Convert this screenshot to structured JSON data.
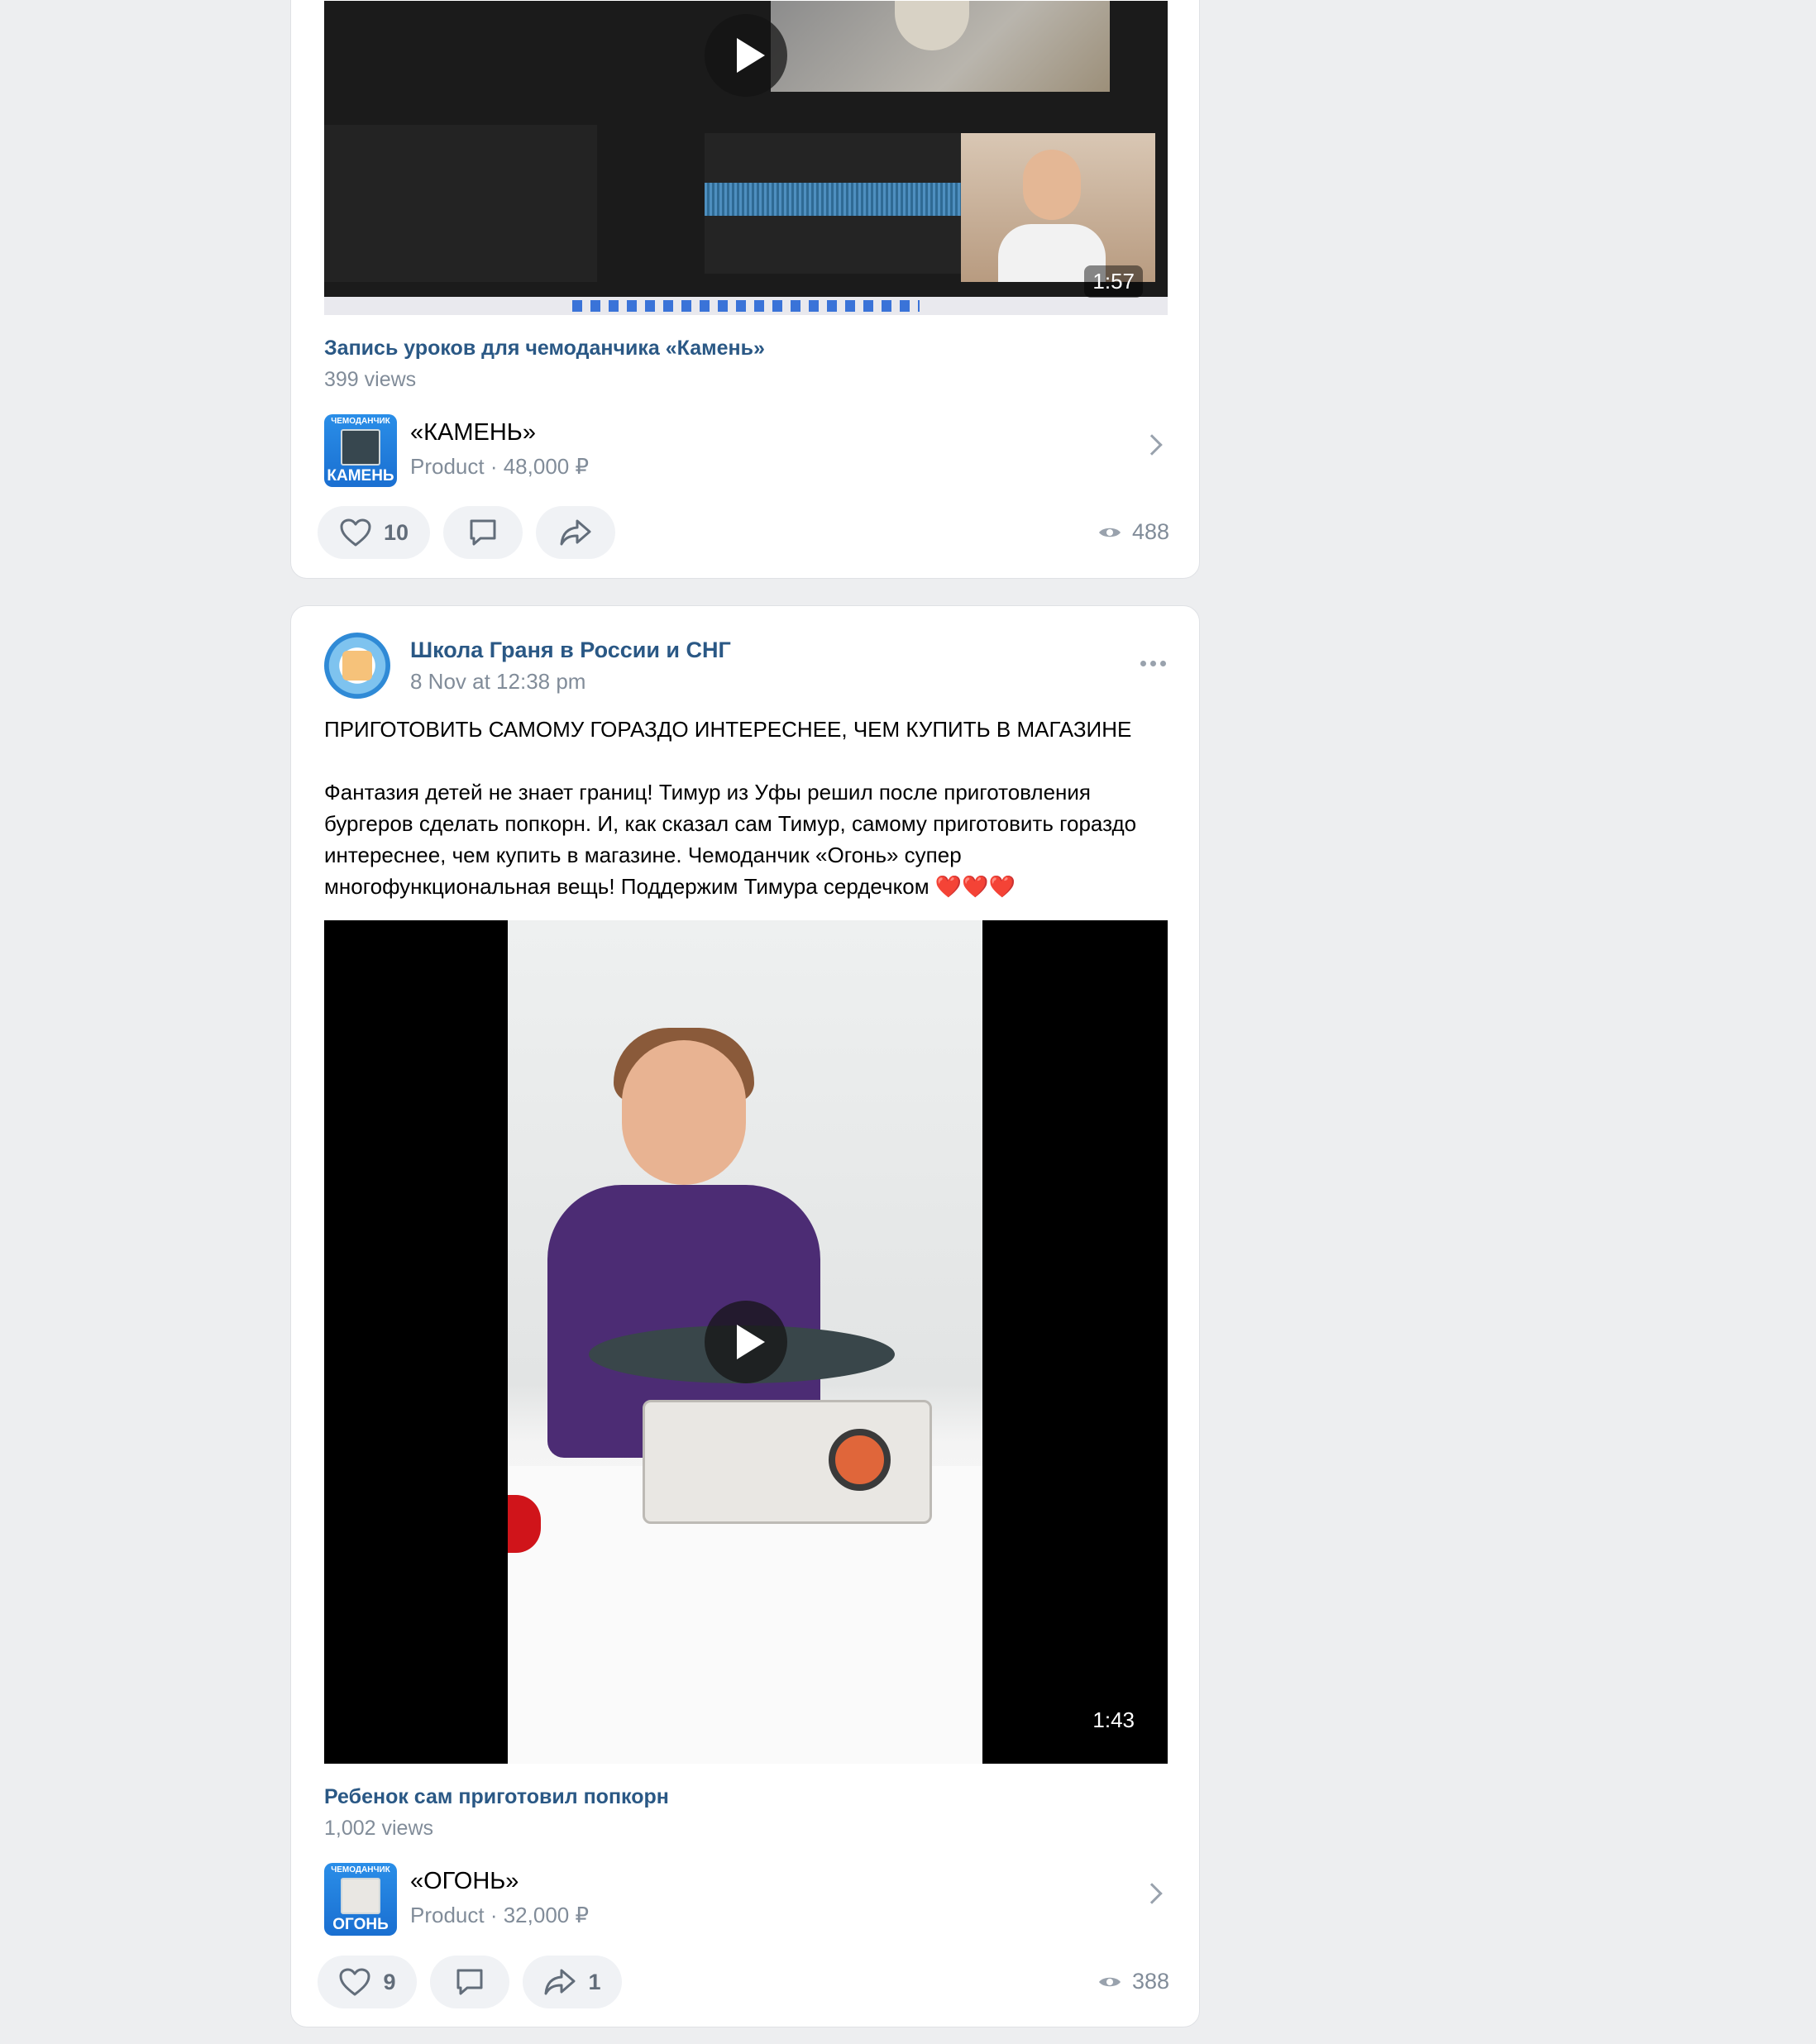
{
  "posts": [
    {
      "video": {
        "title": "Запись уроков для чемоданчика «Камень»",
        "views": "399 views",
        "duration": "1:57"
      },
      "product": {
        "thumb_top": "ЧЕМОДАНЧИК",
        "thumb_bottom": "КАМЕНЬ",
        "name": "«КАМЕНЬ»",
        "meta": "Product · 48,000 ₽"
      },
      "actions": {
        "likes": "10",
        "views": "488"
      }
    },
    {
      "author": "Школа Граня в России и СНГ",
      "date": "8 Nov at 12:38 pm",
      "text": {
        "heading": "ПРИГОТОВИТЬ САМОМУ ГОРАЗДО ИНТЕРЕСНЕЕ, ЧЕМ КУПИТЬ В МАГАЗИНЕ",
        "body": "Фантазия детей не знает границ! Тимур из Уфы решил после приготовления бургеров сделать попкорн. И, как сказал сам Тимур, самому приготовить гораздо интереснее, чем купить в магазине. Чемоданчик «Огонь» супер многофункциональная вещь! Поддержим Тимура сердечком",
        "emoji": "❤️❤️❤️"
      },
      "video": {
        "title": "Ребенок сам приготовил попкорн",
        "views": "1,002 views",
        "duration": "1:43"
      },
      "product": {
        "thumb_top": "ЧЕМОДАНЧИК",
        "thumb_bottom": "ОГОНЬ",
        "name": "«ОГОНЬ»",
        "meta": "Product · 32,000 ₽"
      },
      "actions": {
        "likes": "9",
        "shares": "1",
        "views": "388"
      }
    }
  ],
  "colors": {
    "link": "#2a5885",
    "secondary": "#818c99",
    "background": "#edeef0",
    "heart": "#ff4d2e"
  },
  "icons": [
    "play-icon",
    "chevron-right-icon",
    "heart-icon",
    "comment-icon",
    "share-icon",
    "eye-icon",
    "more-icon"
  ]
}
